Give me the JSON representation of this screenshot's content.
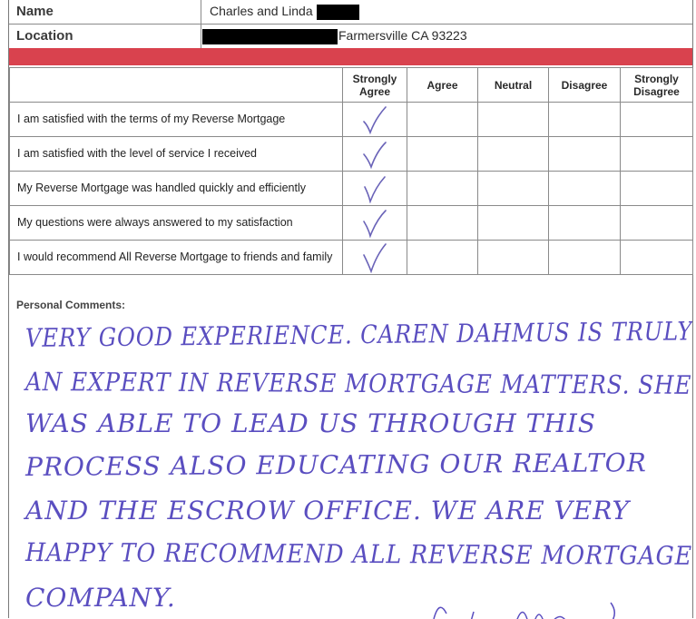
{
  "info": {
    "name_label": "Name",
    "name_value": "Charles and Linda",
    "location_label": "Location",
    "location_value": "Farmersville CA 93223"
  },
  "survey": {
    "columns": [
      "Strongly Agree",
      "Agree",
      "Neutral",
      "Disagree",
      "Strongly Disagree"
    ],
    "rows": [
      {
        "statement": "I am satisfied with the terms of my Reverse Mortgage",
        "selected": "Strongly Agree"
      },
      {
        "statement": "I am satisfied with the level of service I received",
        "selected": "Strongly Agree"
      },
      {
        "statement": "My Reverse Mortgage was handled quickly and efficiently",
        "selected": "Strongly Agree"
      },
      {
        "statement": "My questions were always answered to my satisfaction",
        "selected": "Strongly Agree"
      },
      {
        "statement": "I would recommend All Reverse Mortgage to friends and family",
        "selected": "Strongly Agree"
      }
    ]
  },
  "comments": {
    "label": "Personal Comments:",
    "lines": [
      "VERY GOOD EXPERIENCE.  CAREN DAHMUS IS TRULY",
      "AN EXPERT IN REVERSE MORTGAGE MATTERS. SHE",
      "WAS ABLE TO LEAD US THROUGH THIS",
      "PROCESS ALSO EDUCATING OUR REALTOR",
      "AND THE ESCROW OFFICE.  WE ARE VERY",
      "HAPPY TO RECOMMEND ALL REVERSE MORTGAGE",
      "COMPANY."
    ]
  },
  "colors": {
    "accent_bar": "#d9424e",
    "ink": "#5a4ec0",
    "checkmark": "#6a63b8"
  }
}
